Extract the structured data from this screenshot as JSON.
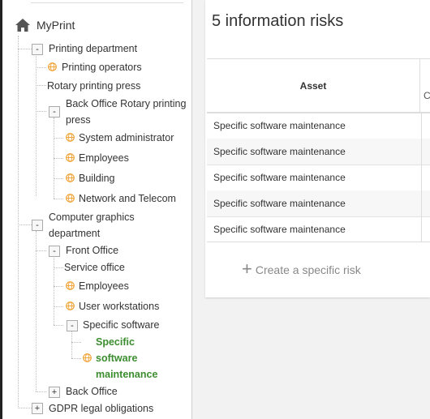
{
  "tree": {
    "root": "MyPrint",
    "printing_department": "Printing department",
    "printing_operators": "Printing operators",
    "rotary_press": "Rotary printing press",
    "back_office_rotary": "Back Office Rotary printing press",
    "system_administrator": "System administrator",
    "employees_1": "Employees",
    "building": "Building",
    "network_telecom": "Network and Telecom",
    "computer_graphics": "Computer graphics department",
    "front_office": "Front Office",
    "service_office": "Service office",
    "employees_2": "Employees",
    "user_workstations": "User workstations",
    "specific_software": "Specific software",
    "specific_software_maintenance": "Specific software maintenance",
    "back_office": "Back Office",
    "gdpr": "GDPR legal obligations",
    "toggle_minus": "-",
    "toggle_plus": "+"
  },
  "panel": {
    "title": "5 information risks",
    "column_asset": "Asset",
    "column_partial": "C",
    "rows": [
      "Specific software maintenance",
      "Specific software maintenance",
      "Specific software maintenance",
      "Specific software maintenance",
      "Specific software maintenance"
    ],
    "create_label": "Create a specific risk"
  },
  "colors": {
    "active_node": "#3c8d2f",
    "globe_icon": "#f0a030"
  },
  "icons": [
    "home-icon",
    "globe-icon",
    "plus-icon"
  ]
}
